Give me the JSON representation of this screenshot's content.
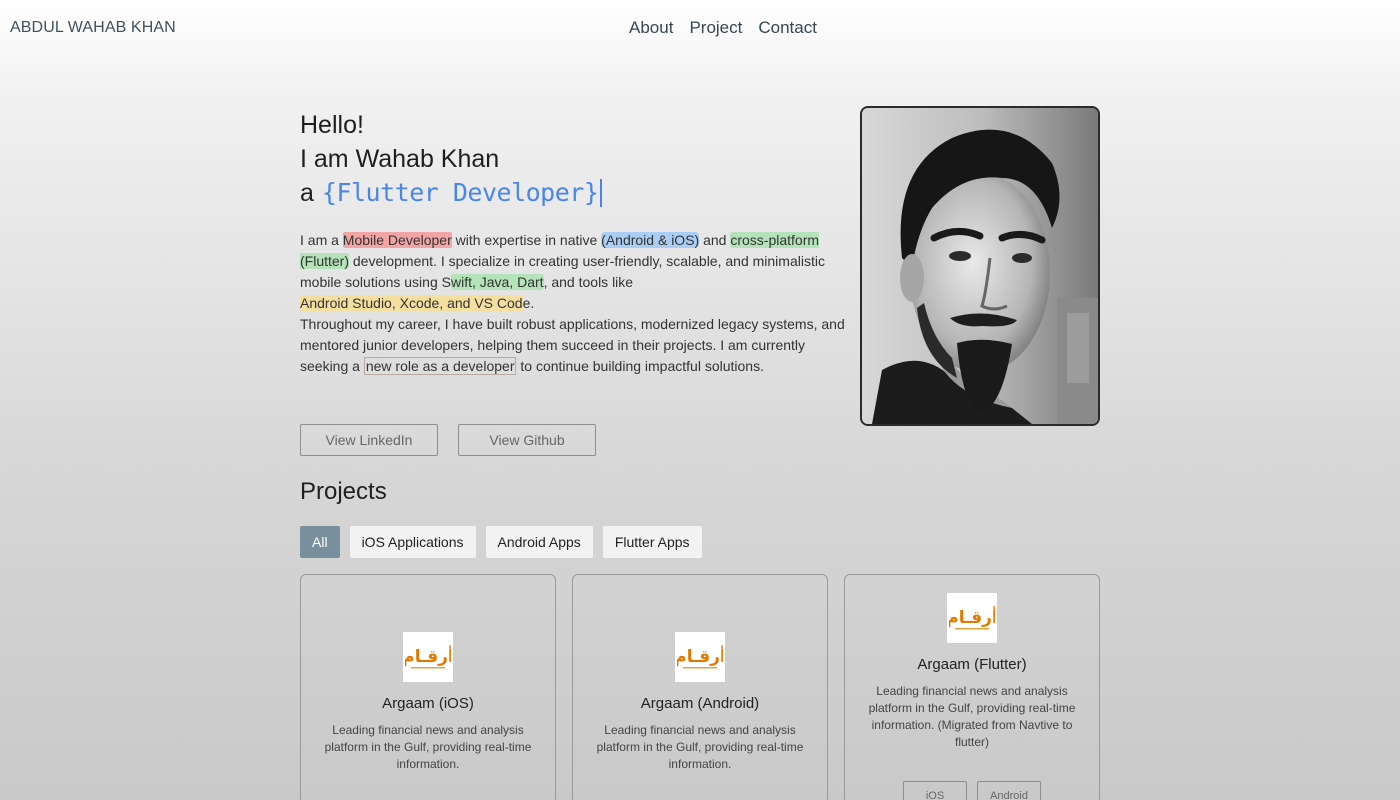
{
  "header": {
    "brand": "ABDUL WAHAB KHAN",
    "nav": [
      "About",
      "Project",
      "Contact"
    ]
  },
  "hero": {
    "line1": "Hello!",
    "line2": "I am Wahab Khan",
    "line3_prefix": "a",
    "role": "{Flutter Developer}",
    "bio": {
      "t1": "I am a ",
      "h1": "Mobile Developer",
      "t2": " with expertise in native ",
      "h2": "(Android & iOS)",
      "t3": " and ",
      "h3": "cross-platform (Flutter)",
      "t4": " development. I specialize in creating user-friendly, scalable, and minimalistic mobile solutions using S",
      "h4": "wift, Java, Dart",
      "t5": ", and tools like ",
      "h5": "Android Studio, Xcode, and VS Cod",
      "t6": "e.",
      "p2a": "Throughout my career, I have built robust applications, modernized legacy systems, and mentored junior developers, helping them succeed in their projects. I am currently seeking a ",
      "h6": "new role as a developer",
      "p2b": " to continue building impactful solutions."
    },
    "buttons": {
      "linkedin": "View LinkedIn",
      "github": "View Github"
    }
  },
  "projects": {
    "title": "Projects",
    "filters": [
      "All",
      "iOS Applications",
      "Android Apps",
      "Flutter Apps"
    ],
    "active_filter": "All",
    "cards": [
      {
        "title": "Argaam (iOS)",
        "desc": "Leading financial news and analysis platform in the Gulf, providing real-time information.",
        "tags": []
      },
      {
        "title": "Argaam (Android)",
        "desc": "Leading financial news and analysis platform in the Gulf, providing real-time information.",
        "tags": []
      },
      {
        "title": "Argaam (Flutter)",
        "desc": "Leading financial news and analysis platform in the Gulf, providing real-time information. (Migrated from Navtive to flutter)",
        "tags": [
          "iOS",
          "Android"
        ]
      }
    ],
    "logo_text": "أرقـام"
  },
  "colors": {
    "accent_blue": "#4a86e8",
    "active_filter": "#78909c",
    "logo_orange": "#e07b00"
  }
}
